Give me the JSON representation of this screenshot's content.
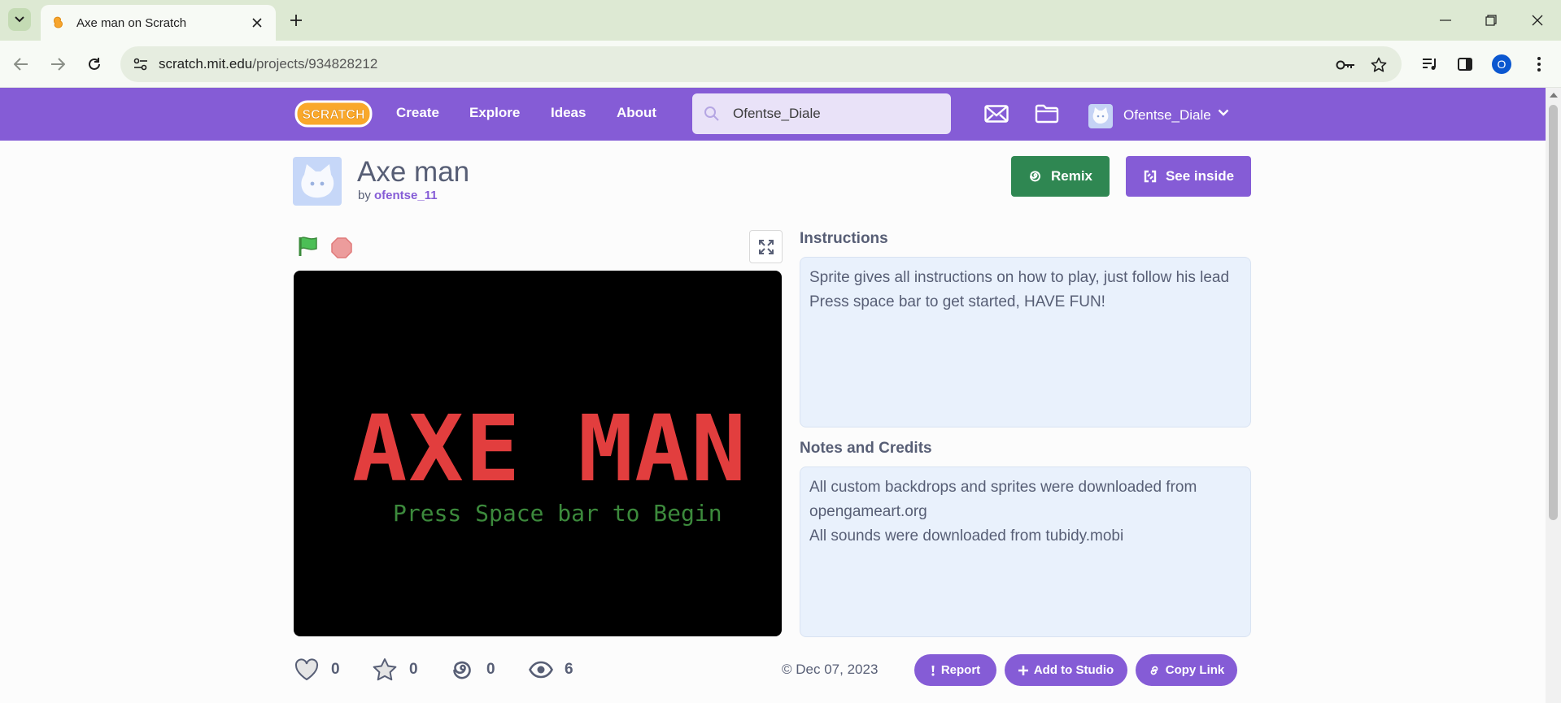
{
  "browser": {
    "tab_title": "Axe man on Scratch",
    "url_host": "scratch.mit.edu",
    "url_path": "/projects/934828212",
    "profile_initial": "O"
  },
  "nav": {
    "logo_text": "SCRATCH",
    "links": [
      "Create",
      "Explore",
      "Ideas",
      "About"
    ],
    "search_value": "Ofentse_Diale",
    "username": "Ofentse_Diale"
  },
  "project": {
    "title": "Axe man",
    "by_prefix": "by",
    "author": "ofentse_11",
    "remix_label": "Remix",
    "see_inside_label": "See inside"
  },
  "stage": {
    "title_text": "AXE MAN",
    "subtitle_text": "Press Space bar to Begin"
  },
  "instructions": {
    "label": "Instructions",
    "text": "Sprite gives all instructions on how to play, just follow his lead\nPress space bar to get started, HAVE FUN!"
  },
  "notes": {
    "label": "Notes and Credits",
    "text": "All custom backdrops and sprites were downloaded from opengameart.org\nAll sounds were downloaded from tubidy.mobi"
  },
  "stats": {
    "loves": "0",
    "favorites": "0",
    "remixes": "0",
    "views": "6",
    "date": "Dec 07, 2023"
  },
  "actions": {
    "report": "Report",
    "add_to_studio": "Add to Studio",
    "copy_link": "Copy Link"
  },
  "colors": {
    "scratch_purple": "#855cd6",
    "remix_green": "#2f8752",
    "stage_title_red": "#e23e3e",
    "stage_sub_green": "#3c8a3c"
  }
}
